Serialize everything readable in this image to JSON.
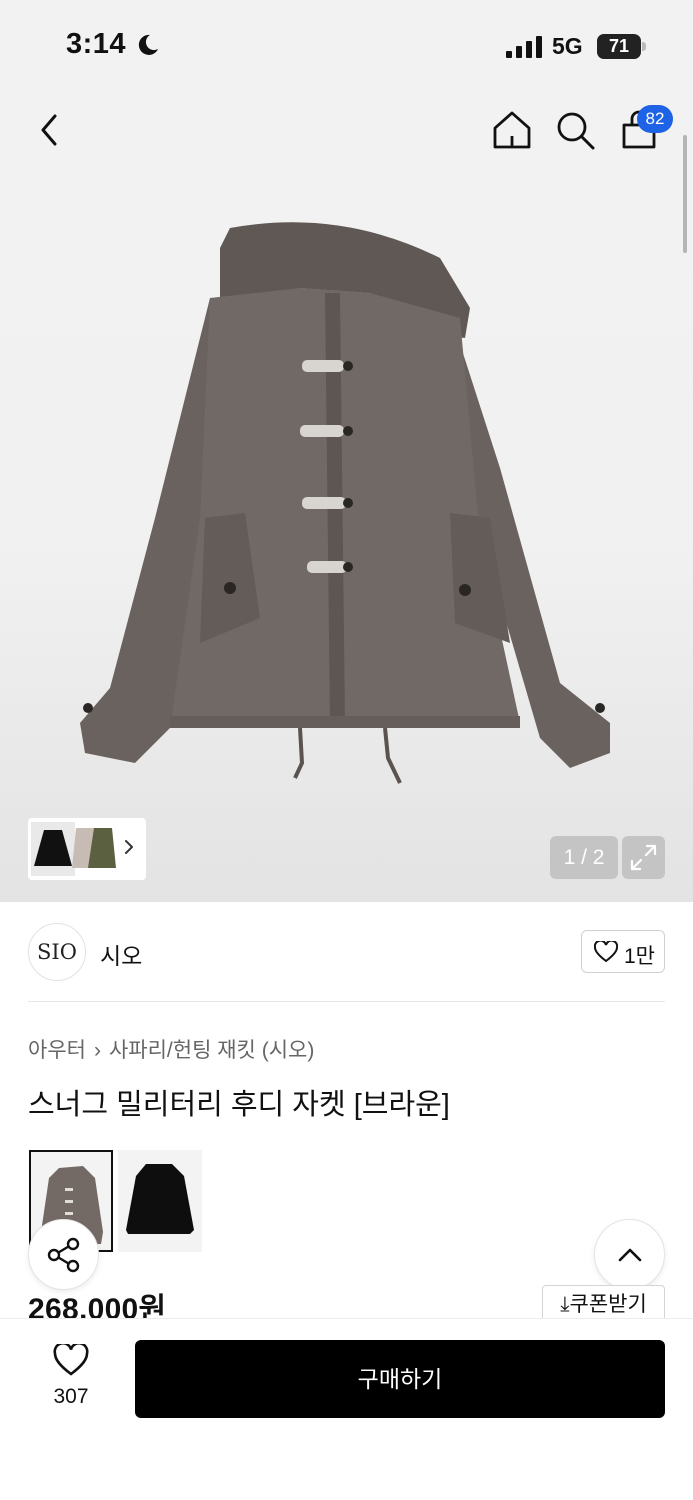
{
  "status_bar": {
    "time": "3:14",
    "network": "5G",
    "battery": "71"
  },
  "header": {
    "cart_count": "82",
    "icons": [
      "back-chevron-icon",
      "home-icon",
      "search-icon",
      "shopping-bag-icon"
    ]
  },
  "gallery": {
    "counter": "1 / 2",
    "expand_icon": "expand-icon"
  },
  "brand": {
    "logo_text": "SIO",
    "name": "시오",
    "likes": "1만"
  },
  "product": {
    "breadcrumb": [
      "아우터",
      "사파리/헌팅 재킷 (시오)"
    ],
    "title": "스너그 밀리터리 후디 자켓 [브라운]",
    "price": "268,000원",
    "coupon_label": "쿠폰받기",
    "variants": [
      "brown",
      "black"
    ]
  },
  "bottom_bar": {
    "wish_count": "307",
    "buy_label": "구매하기"
  },
  "colors": {
    "badge": "#1e63e6",
    "jacket": "#6d6561",
    "buy_button": "#000000"
  }
}
